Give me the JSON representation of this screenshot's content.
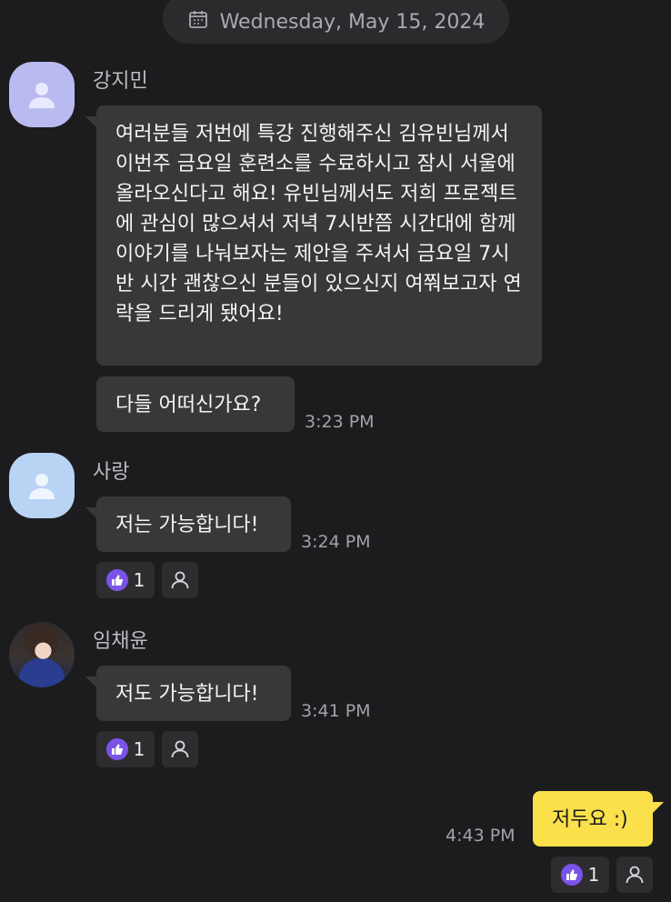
{
  "date_divider": {
    "label": "Wednesday, May 15, 2024",
    "icon": "calendar-icon"
  },
  "messages": [
    {
      "sender": "강지민",
      "avatar": "person-icon",
      "avatar_color": "#b9bbf0",
      "bubbles": [
        "여러분들 저번에 특강 진행해주신 김유빈님께서 이번주 금요일 훈련소를 수료하시고 잠시 서울에 올라오신다고 해요! 유빈님께서도 저희 프로젝트에 관심이 많으셔서 저녁 7시반쯤 시간대에 함께 이야기를 나눠보자는 제안을 주셔서 금요일 7시반 시간 괜찮으신 분들이 있으신지 여쭤보고자 연락을 드리게 됐어요!",
        "다들 어떠신가요?"
      ],
      "time": "3:23 PM"
    },
    {
      "sender": "사랑",
      "avatar": "person-icon",
      "avatar_color": "#b9d3f4",
      "bubbles": [
        "저는 가능합니다!"
      ],
      "time": "3:24 PM",
      "reaction": {
        "icon": "thumbs-up-icon",
        "count": "1"
      }
    },
    {
      "sender": "임채윤",
      "avatar": "profile-photo",
      "bubbles": [
        "저도 가능합니다!"
      ],
      "time": "3:41 PM",
      "reaction": {
        "icon": "thumbs-up-icon",
        "count": "1"
      }
    },
    {
      "sender": "me",
      "bubbles": [
        "저두요 :)"
      ],
      "time": "4:43 PM",
      "reaction": {
        "icon": "thumbs-up-icon",
        "count": "1"
      }
    }
  ],
  "colors": {
    "background": "#1c1c1e",
    "bubble_other": "#38383b",
    "bubble_me": "#fae04b",
    "reaction_accent": "#7b53e8"
  }
}
